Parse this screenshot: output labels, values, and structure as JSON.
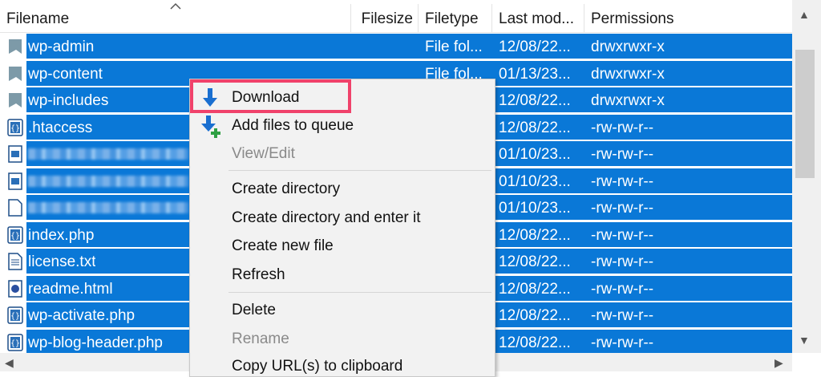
{
  "columns": [
    {
      "label": "Filename"
    },
    {
      "label": "Filesize"
    },
    {
      "label": "Filetype"
    },
    {
      "label": "Last mod..."
    },
    {
      "label": "Permissions"
    }
  ],
  "files": [
    {
      "name": "wp-admin",
      "type": "File fol...",
      "modified": "12/08/22...",
      "perms": "drwxrwxr-x",
      "icon": "folder-icon",
      "selected": true
    },
    {
      "name": "wp-content",
      "type": "File fol...",
      "modified": "01/13/23...",
      "perms": "drwxrwxr-x",
      "icon": "folder-icon",
      "selected": true
    },
    {
      "name": "wp-includes",
      "type": "",
      "modified": "12/08/22...",
      "perms": "drwxrwxr-x",
      "icon": "folder-icon",
      "selected": true
    },
    {
      "name": ".htaccess",
      "type": "",
      "modified": "12/08/22...",
      "perms": "-rw-rw-r--",
      "icon": "code-file-icon",
      "selected": true
    },
    {
      "name": "",
      "type": "",
      "modified": "01/10/23...",
      "perms": "-rw-rw-r--",
      "icon": "image-file-icon",
      "selected": true,
      "blurred": true
    },
    {
      "name": "",
      "type": "",
      "modified": "01/10/23...",
      "perms": "-rw-rw-r--",
      "icon": "image-file-icon",
      "selected": true,
      "blurred": true
    },
    {
      "name": "",
      "type": "",
      "modified": "01/10/23...",
      "perms": "-rw-rw-r--",
      "icon": "file-icon",
      "selected": true,
      "blurred": true
    },
    {
      "name": "index.php",
      "type": "",
      "modified": "12/08/22...",
      "perms": "-rw-rw-r--",
      "icon": "code-file-icon",
      "selected": true
    },
    {
      "name": "license.txt",
      "type": "",
      "modified": "12/08/22...",
      "perms": "-rw-rw-r--",
      "icon": "text-file-icon",
      "selected": true
    },
    {
      "name": "readme.html",
      "type": "",
      "modified": "12/08/22...",
      "perms": "-rw-rw-r--",
      "icon": "html-file-icon",
      "selected": true
    },
    {
      "name": "wp-activate.php",
      "type": "",
      "modified": "12/08/22...",
      "perms": "-rw-rw-r--",
      "icon": "code-file-icon",
      "selected": true
    },
    {
      "name": "wp-blog-header.php",
      "type": "",
      "modified": "12/08/22...",
      "perms": "-rw-rw-r--",
      "icon": "code-file-icon",
      "selected": true
    }
  ],
  "context_menu": {
    "items": [
      {
        "label": "Download",
        "icon": "download-arrow-icon",
        "disabled": false,
        "highlighted": true
      },
      {
        "label": "Add files to queue",
        "icon": "add-queue-icon",
        "disabled": false
      },
      {
        "label": "View/Edit",
        "disabled": true
      },
      {
        "label": "Create directory",
        "disabled": false
      },
      {
        "label": "Create directory and enter it",
        "disabled": false
      },
      {
        "label": "Create new file",
        "disabled": false
      },
      {
        "label": "Refresh",
        "disabled": false
      },
      {
        "label": "Delete",
        "disabled": false
      },
      {
        "label": "Rename",
        "disabled": true
      },
      {
        "label": "Copy URL(s) to clipboard",
        "disabled": false
      }
    ]
  },
  "colors": {
    "selection": "#0a78d7",
    "highlight_box": "#f0426b",
    "menu_bg": "#f2f2f2"
  }
}
